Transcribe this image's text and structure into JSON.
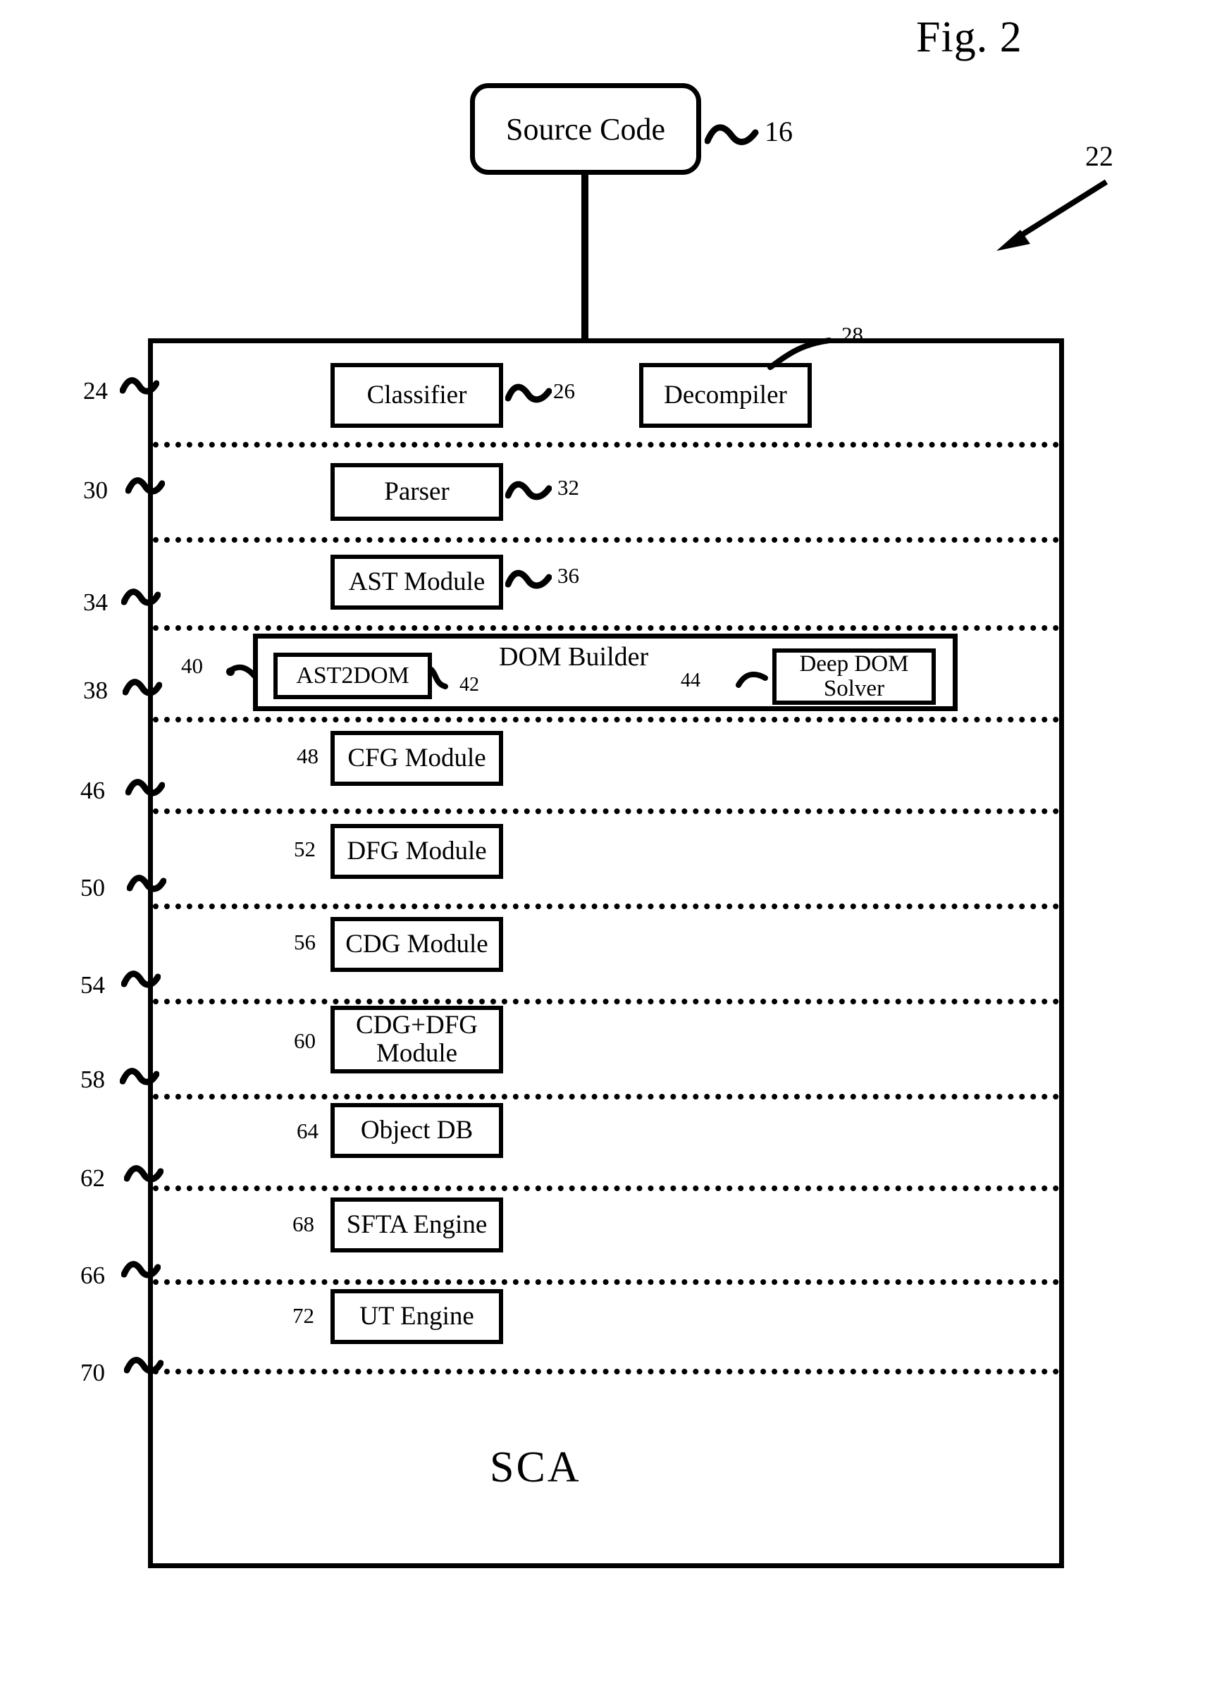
{
  "figure": {
    "title": "Fig. 2",
    "system_ref": "22"
  },
  "source": {
    "label": "Source Code",
    "ref": "16"
  },
  "container": {
    "label": "SCA"
  },
  "layers": [
    {
      "layer_ref": "24",
      "boxes": [
        {
          "label": "Classifier",
          "ref": "26",
          "ref_side": "right"
        },
        {
          "label": "Decompiler",
          "ref": "28",
          "ref_side": "leader"
        }
      ]
    },
    {
      "layer_ref": "30",
      "boxes": [
        {
          "label": "Parser",
          "ref": "32",
          "ref_side": "right"
        }
      ]
    },
    {
      "layer_ref": "34",
      "boxes": [
        {
          "label": "AST Module",
          "ref": "36",
          "ref_side": "right"
        }
      ]
    },
    {
      "layer_ref": "38",
      "group": {
        "ref": "40",
        "title": "DOM Builder",
        "boxes": [
          {
            "label": "AST2DOM",
            "ref": "42",
            "ref_side": "right"
          },
          {
            "label": "Deep DOM Solver",
            "line1": "Deep DOM",
            "line2": "Solver",
            "ref": "44",
            "ref_side": "left"
          }
        ]
      }
    },
    {
      "layer_ref": "46",
      "boxes": [
        {
          "label": "CFG Module",
          "ref": "48",
          "ref_side": "left"
        }
      ]
    },
    {
      "layer_ref": "50",
      "boxes": [
        {
          "label": "DFG Module",
          "ref": "52",
          "ref_side": "left"
        }
      ]
    },
    {
      "layer_ref": "54",
      "boxes": [
        {
          "label": "CDG Module",
          "ref": "56",
          "ref_side": "left"
        }
      ]
    },
    {
      "layer_ref": "58",
      "boxes": [
        {
          "label": "CDG+DFG Module",
          "line1": "CDG+DFG",
          "line2": "Module",
          "ref": "60",
          "ref_side": "left"
        }
      ]
    },
    {
      "layer_ref": "62",
      "boxes": [
        {
          "label": "Object DB",
          "ref": "64",
          "ref_side": "left"
        }
      ]
    },
    {
      "layer_ref": "66",
      "boxes": [
        {
          "label": "SFTA Engine",
          "ref": "68",
          "ref_side": "left"
        }
      ]
    },
    {
      "layer_ref": "70",
      "boxes": [
        {
          "label": "UT Engine",
          "ref": "72",
          "ref_side": "left"
        }
      ]
    }
  ]
}
